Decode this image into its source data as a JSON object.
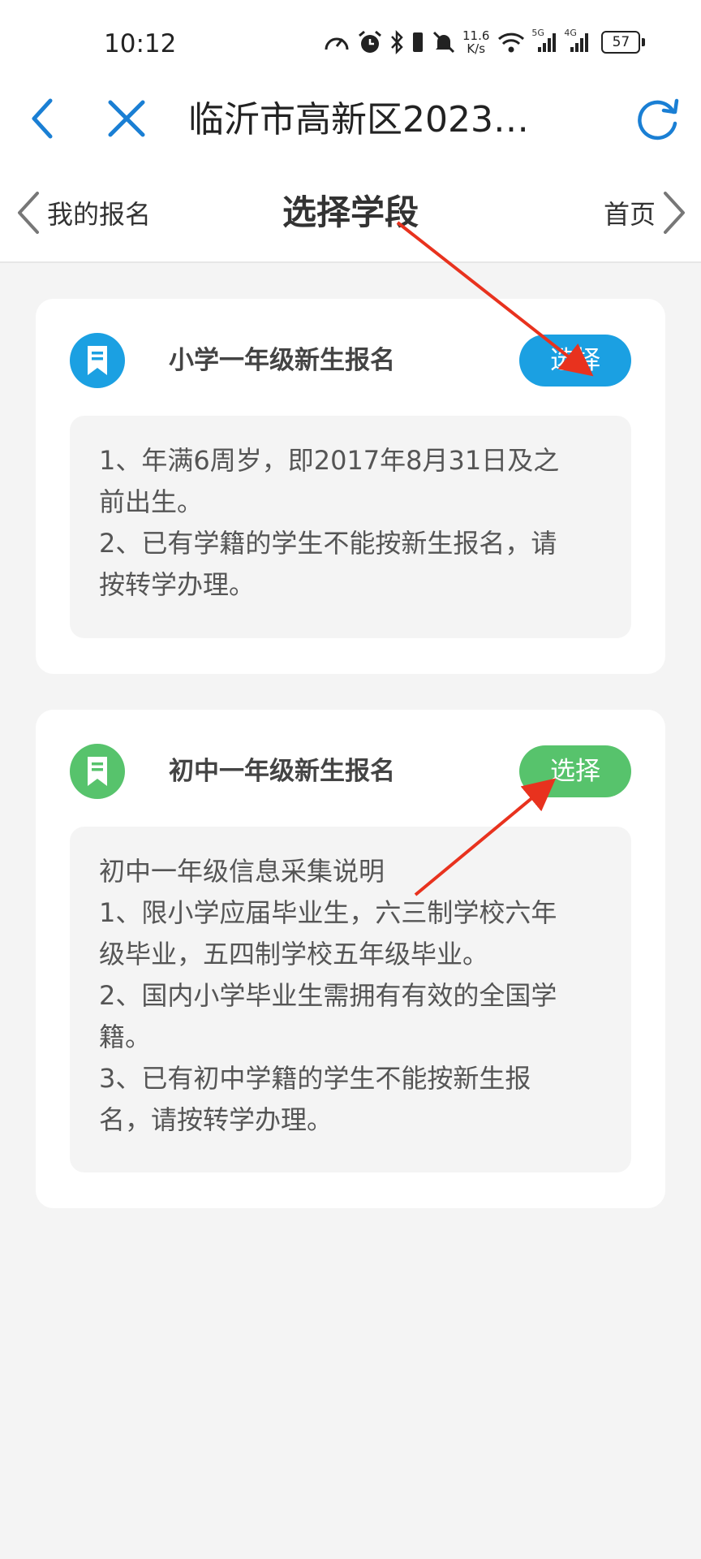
{
  "status_bar": {
    "time": "10:12",
    "net_speed_value": "11.6",
    "net_speed_unit": "K/s",
    "signal_1_label": "5G",
    "signal_2_label": "4G",
    "battery": "57",
    "icons": [
      "speed-icon",
      "alarm-icon",
      "bluetooth-icon",
      "vibrate-icon",
      "mute-icon",
      "wifi-icon",
      "signal-icon",
      "battery-icon"
    ]
  },
  "browser": {
    "title": "临沂市高新区2023…",
    "icons": [
      "back-icon",
      "close-icon",
      "refresh-icon"
    ]
  },
  "nav": {
    "left_label": "我的报名",
    "title": "选择学段",
    "right_label": "首页"
  },
  "cards": [
    {
      "title": "小学一年级新生报名",
      "button": "选择",
      "accent": "#1ba0e2",
      "lines": [
        "1、年满6周岁，即2017年8月31日及之",
        "前出生。",
        "2、已有学籍的学生不能按新生报名，请",
        "按转学办理。"
      ]
    },
    {
      "title": "初中一年级新生报名",
      "button": "选择",
      "accent": "#57c36c",
      "lines": [
        "初中一年级信息采集说明",
        "1、限小学应届毕业生，六三制学校六年",
        "级毕业，五四制学校五年级毕业。",
        "2、国内小学毕业生需拥有有效的全国学",
        "籍。",
        "3、已有初中学籍的学生不能按新生报",
        "名，请按转学办理。"
      ]
    }
  ],
  "colors": {
    "page_bg": "#f4f4f4",
    "browser_icon": "#1a7fd4",
    "arrow": "#e8321e"
  }
}
